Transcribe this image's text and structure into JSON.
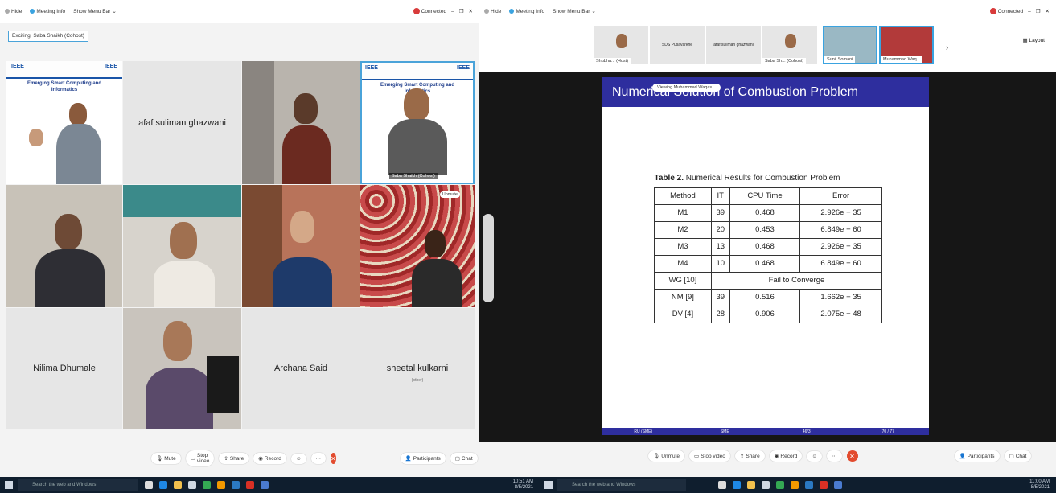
{
  "left": {
    "menu": [
      "Hide",
      "Meeting Info",
      "Show Menu Bar"
    ],
    "connected": "Connected",
    "focus_label": "Exciting: Saba Shaikh (Cohost)",
    "tiles": {
      "aafaf": "afaf suliman ghazwani",
      "saba_chip": "Saba Shaikh (Cohost)",
      "unmute_chip": "Unmute",
      "nilima": "Nilima Dhumale",
      "archana": "Archana Said",
      "sheetal": "sheetal kulkarni",
      "sheetal_sub": "(other)"
    },
    "poster": {
      "ieee": "IEEE",
      "title": "Emerging Smart Computing and Informatics"
    },
    "toolbar": [
      "Mute",
      "Stop video",
      "Share",
      "Record",
      "Participants",
      "Chat"
    ]
  },
  "right": {
    "menu": [
      "Hide",
      "Meeting Info",
      "Show Menu Bar"
    ],
    "connected": "Connected",
    "layout": "Layout",
    "thumbs": [
      "Shubha... (Host)",
      "SDS Pusavarkhe",
      "afaf suliman ghazwani",
      "Saba Sh... (Cohost)",
      "Sunil Somani",
      "Muhammad Waq..."
    ],
    "viewing": "Viewing Muhammad Waqas...",
    "slide": {
      "title": "Numerical Solution of Combustion Problem",
      "caption_bold": "Table 2.",
      "caption": "Numerical Results for Combustion Problem",
      "headers": [
        "Method",
        "IT",
        "CPU Time",
        "Error"
      ],
      "rows": [
        [
          "M1",
          "39",
          "0.468",
          "2.926e − 35"
        ],
        [
          "M2",
          "20",
          "0.453",
          "6.849e − 60"
        ],
        [
          "M3",
          "13",
          "0.468",
          "2.926e − 35"
        ],
        [
          "M4",
          "10",
          "0.468",
          "6.849e − 60"
        ]
      ],
      "wg": [
        "WG [10]",
        "Fail to Converge"
      ],
      "rows2": [
        [
          "NM [9]",
          "39",
          "0.516",
          "1.662e − 35"
        ],
        [
          "DV [4]",
          "28",
          "0.906",
          "2.075e − 48"
        ]
      ],
      "footer": [
        "RU (SME)",
        "SME",
        "46/3",
        "70 / 77"
      ]
    },
    "toolbar": [
      "Unmute",
      "Stop video",
      "Share",
      "Record",
      "Participants",
      "Chat"
    ]
  },
  "taskbar": {
    "search_left": "Search the web and Windows",
    "search_right": "Search the web and Windows",
    "time_left": "10:51 AM",
    "date_left": "8/5/2021",
    "time_right": "11:00 AM",
    "date_right": "8/5/2021"
  },
  "colors": {
    "accent": "#2e2e9e",
    "end": "#e24b2e",
    "taskbar": "#0f1e2e",
    "connected": "#d83b3b"
  }
}
